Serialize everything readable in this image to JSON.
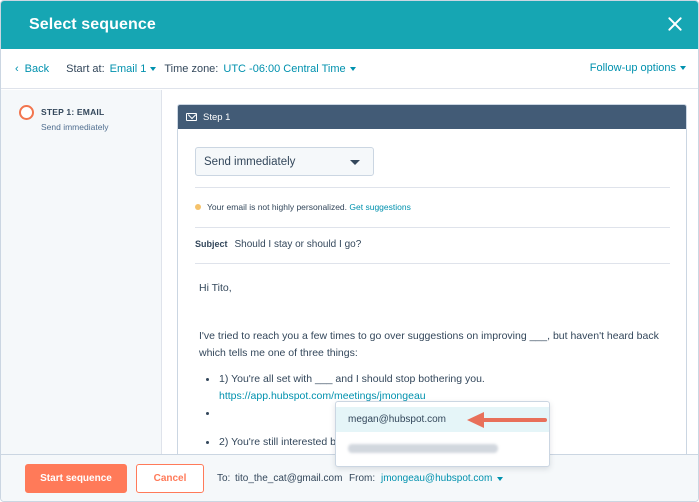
{
  "header": {
    "title": "Select sequence"
  },
  "toolbar": {
    "back_label": "Back",
    "start_at_label": "Start at:",
    "start_at_value": "Email 1",
    "time_zone_label": "Time zone:",
    "time_zone_value": "UTC -06:00 Central Time",
    "followup_label": "Follow-up options"
  },
  "sidebar": {
    "steps": [
      {
        "title": "STEP 1: EMAIL",
        "subtitle": "Send immediately"
      }
    ]
  },
  "step_card": {
    "title": "Step 1",
    "send_dropdown": "Send immediately",
    "notice_text": "Your email is not highly personalized.",
    "notice_link": "Get suggestions",
    "subject_label": "Subject",
    "subject_value": "Should I stay or should I go?",
    "body": {
      "greeting": "Hi Tito,",
      "para1_line1": "I've tried to reach you a few times to go over suggestions on improving ___, but haven't heard back",
      "para1_line2": "which tells me one of three things:",
      "item1": "1) You're all set with ___ and I should stop bothering you.",
      "item1_link": "https://app.hubspot.com/meetings/jmongeau",
      "item3": "2) You're still interested but"
    }
  },
  "footer": {
    "start_button": "Start sequence",
    "cancel_button": "Cancel",
    "to_label": "To:",
    "to_value": "tito_the_cat@gmail.com",
    "from_label": "From:",
    "from_value": "jmongeau@hubspot.com"
  },
  "from_popover": {
    "options": [
      "megan@hubspot.com"
    ]
  },
  "colors": {
    "header_bg": "#16a6b3",
    "accent_orange": "#ff7a59",
    "link": "#0091ae",
    "card_header": "#425b76",
    "annotation_arrow": "#e8705a"
  }
}
